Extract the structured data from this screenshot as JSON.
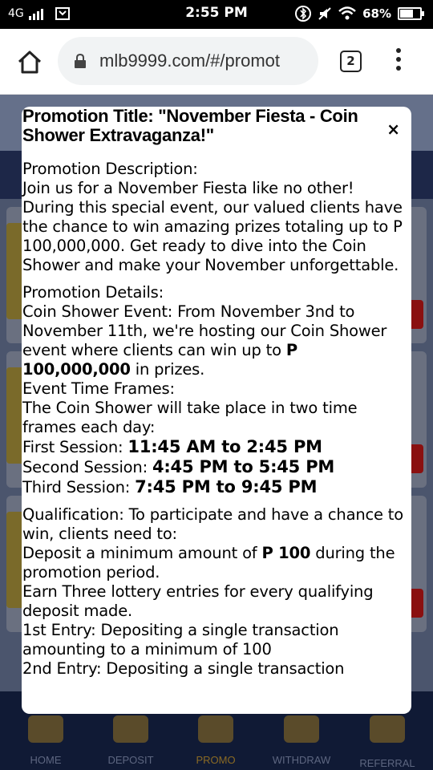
{
  "status_bar": {
    "network": "4G",
    "time": "2:55 PM",
    "battery": "68%",
    "battery_level": 0.68
  },
  "browser": {
    "url": "mlb9999.com/#/promot",
    "tab_count": "2"
  },
  "bottom_nav": {
    "items": [
      {
        "label": "HOME",
        "icon": "home-icon"
      },
      {
        "label": "DEPOSIT",
        "icon": "deposit-icon"
      },
      {
        "label": "PROMO",
        "icon": "promo-gift-icon"
      },
      {
        "label": "WITHDRAW",
        "icon": "withdraw-coins-icon"
      },
      {
        "label": "REFERRAL",
        "icon": "referral-people-icon"
      }
    ],
    "active": "PROMO"
  },
  "modal": {
    "title": "Promotion Title: \"November Fiesta - Coin Shower Extravaganza!\"",
    "close_symbol": "×",
    "description_heading": "Promotion Description:",
    "description_text": "Join us for a November Fiesta like no other! During this special event, our valued clients have the chance to win amazing prizes totaling up to P 100,000,000. Get ready to dive into the Coin Shower and make your November unforgettable.",
    "details_heading": "Promotion Details:",
    "details_text": "Coin Shower Event: From November 3nd to November 11th, we're hosting our Coin Shower event where clients can win up to ",
    "details_amount": "P 100,000,000",
    "details_suffix": " in prizes.",
    "time_frames_heading": "Event Time Frames:",
    "time_frames_text": "The Coin Shower will take place in two time frames each day:",
    "sessions": [
      {
        "label": "First Session: ",
        "time": "11:45 AM to 2:45 PM"
      },
      {
        "label": "Second Session: ",
        "time": "4:45 PM to 5:45 PM"
      },
      {
        "label": "Third Session: ",
        "time": "7:45 PM to 9:45 PM"
      }
    ],
    "qualification_text": "Qualification: To participate and have a chance to win, clients need to:",
    "deposit_prefix": "Deposit a minimum amount of ",
    "deposit_amount": "P 100",
    "deposit_suffix": " during the promotion period.",
    "entries_text": "Earn Three lottery entries for every qualifying deposit made.",
    "entry_1": "1st Entry: Depositing a single transaction amounting to a minimum of 100",
    "entry_2": "2nd Entry: Depositing a single transaction"
  }
}
